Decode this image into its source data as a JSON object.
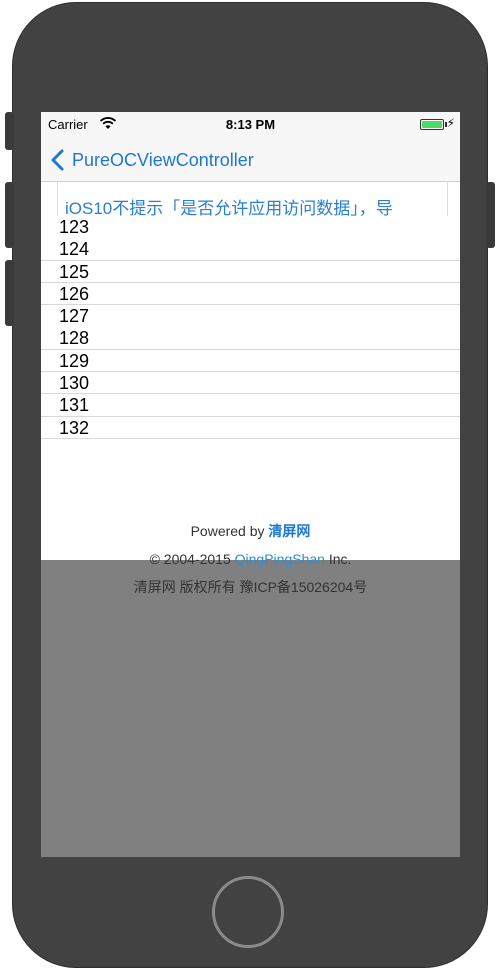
{
  "status_bar": {
    "carrier": "Carrier",
    "time": "8:13 PM",
    "wifi_icon": "wifi-icon",
    "battery_icon": "battery-icon"
  },
  "nav": {
    "back_label": "PureOCViewController",
    "back_icon": "chevron-left-icon"
  },
  "content": {
    "title": "iOS10不提示「是否允许应用访问数据」，导",
    "items": [
      "123",
      "124",
      "125",
      "126",
      "127",
      "128",
      "129",
      "130",
      "131",
      "132"
    ]
  },
  "footer": {
    "powered_prefix": "Powered by",
    "powered_brand": "清屏网",
    "copyright_prefix": "© 2004-2015",
    "copyright_link": "QingPingShan",
    "copyright_suffix": "Inc.",
    "icp": "清屏网 版权所有 豫ICP备15026204号"
  },
  "colors": {
    "accent": "#1e78d2",
    "device_body": "#424242",
    "screen_backdrop": "#808080"
  }
}
